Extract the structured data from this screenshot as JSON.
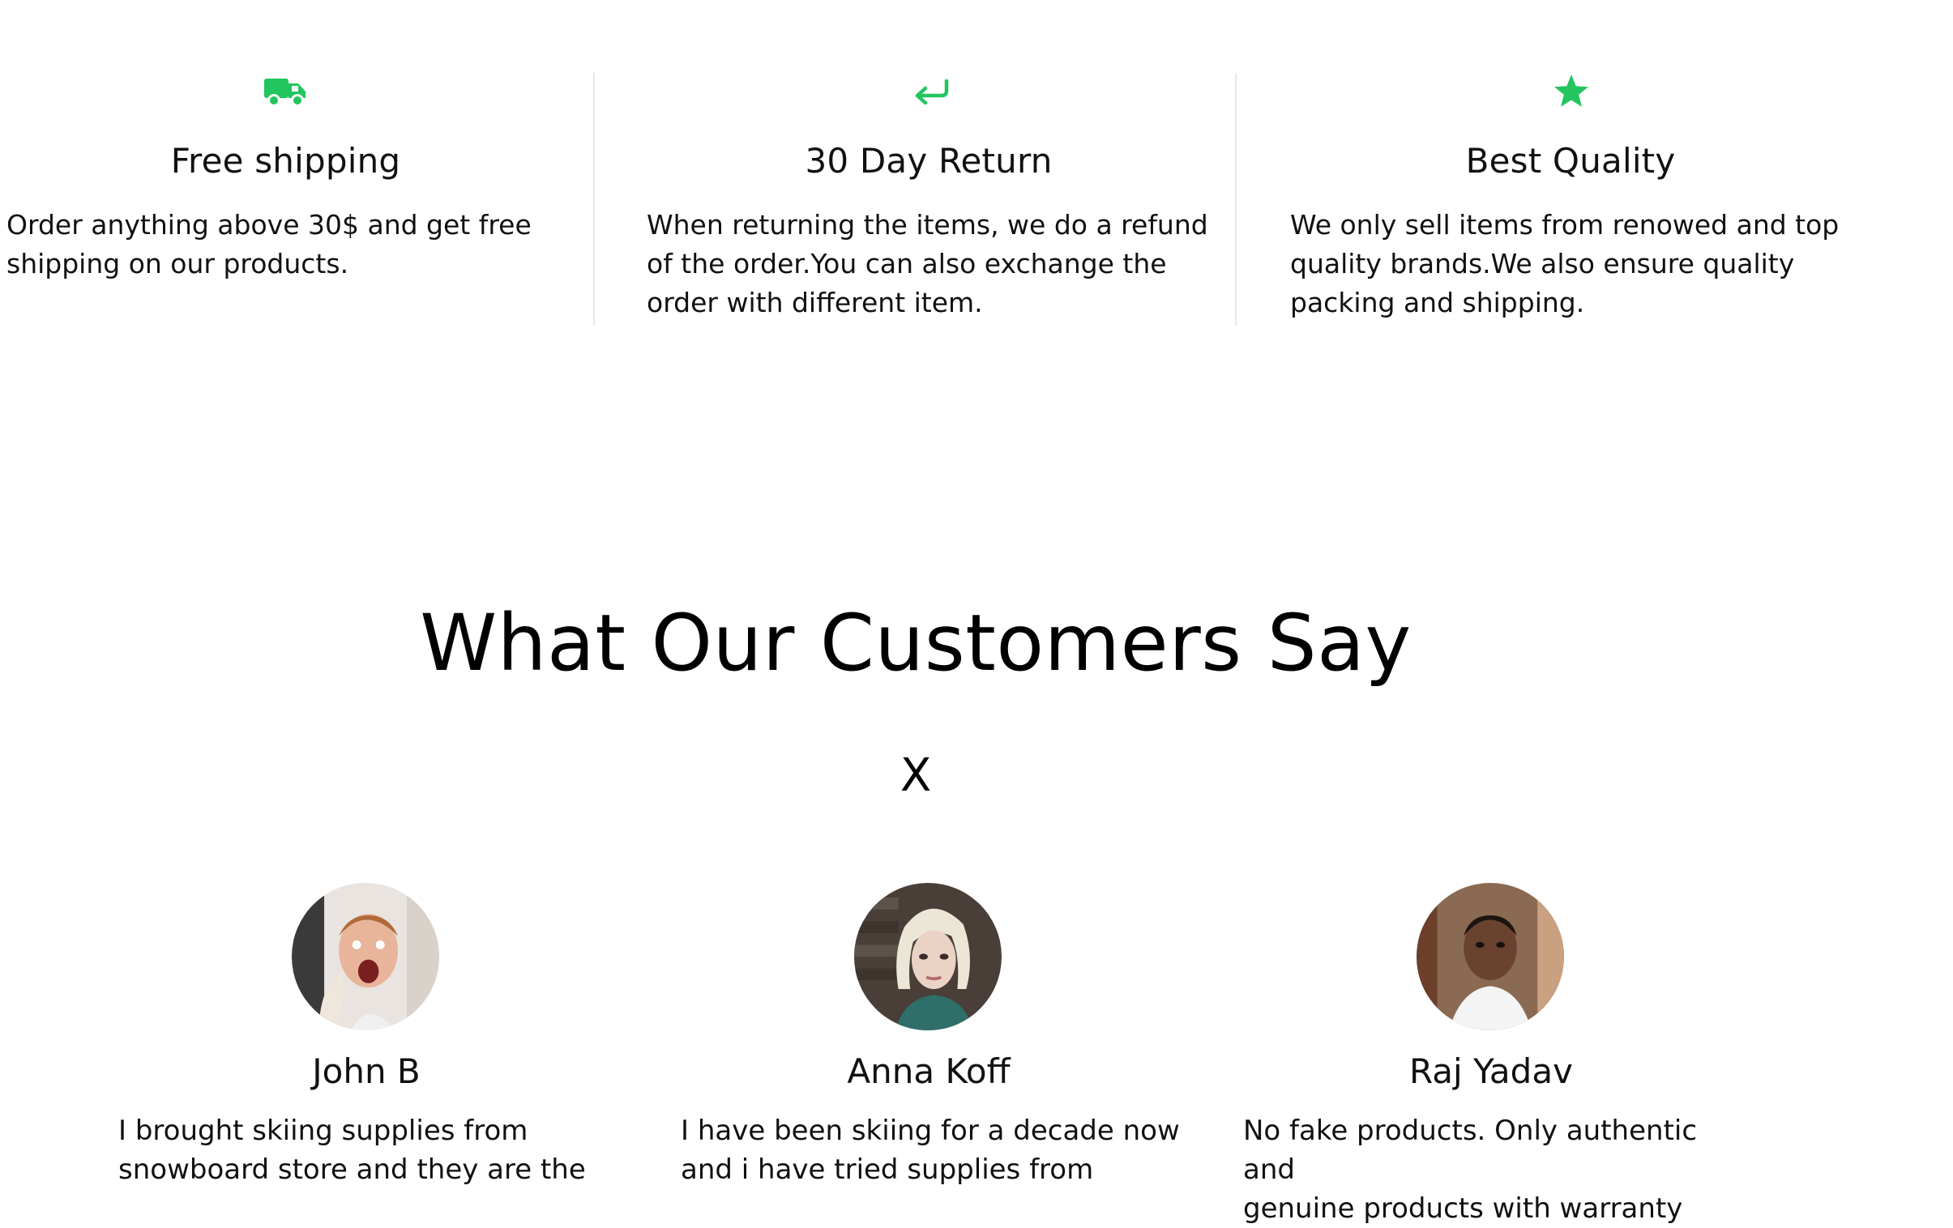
{
  "colors": {
    "accent": "#22c55e",
    "text": "#111111",
    "divider": "#e8e8e8"
  },
  "features": [
    {
      "icon": "truck-icon",
      "title": "Free shipping",
      "lines": [
        "Order anything above 30$ and get free",
        "shipping on our products."
      ]
    },
    {
      "icon": "return-arrow-icon",
      "title": "30 Day Return",
      "lines": [
        "When returning the items, we do a refund",
        "of the order.You can also exchange the",
        "order with different item."
      ]
    },
    {
      "icon": "star-icon",
      "title": "Best Quality",
      "lines": [
        "We only sell items from renowed and top",
        "quality brands.We also ensure quality",
        "packing and shipping."
      ]
    }
  ],
  "testimonials_section": {
    "title": "What Our Customers Say",
    "close_label": "X"
  },
  "testimonials": [
    {
      "name": "John B",
      "lines": [
        "I brought skiing supplies from",
        "snowboard store and they are the"
      ]
    },
    {
      "name": "Anna Koff",
      "lines": [
        "I have been skiing for a decade now",
        "and i have tried supplies from"
      ]
    },
    {
      "name": "Raj Yadav",
      "lines": [
        "No fake products. Only authentic and",
        "genuine products with warranty"
      ]
    }
  ]
}
